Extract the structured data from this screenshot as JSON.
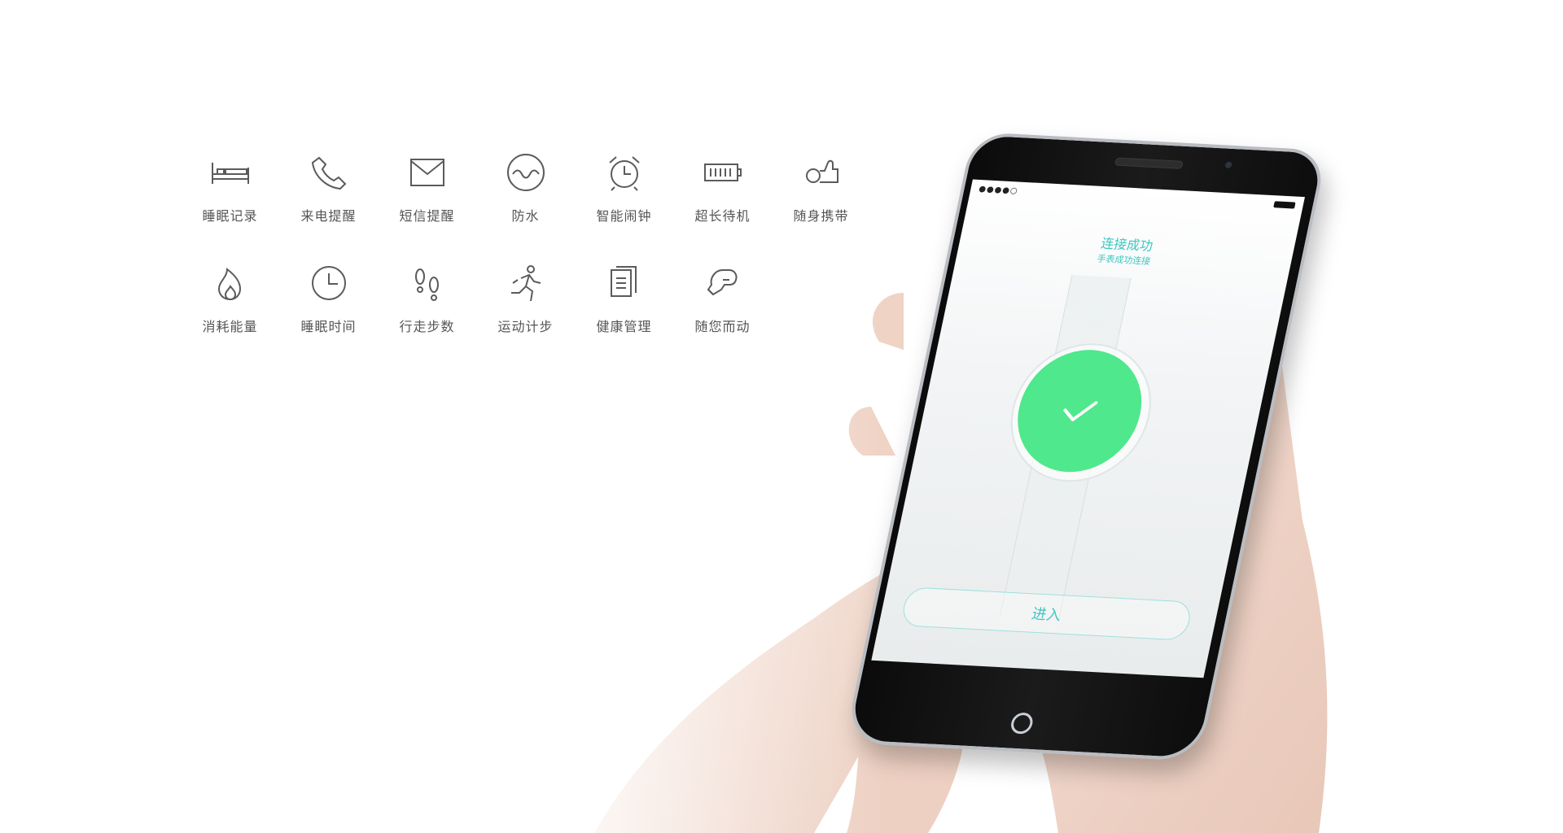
{
  "features": {
    "row1": [
      {
        "label": "睡眠记录",
        "icon": "bed-icon"
      },
      {
        "label": "来电提醒",
        "icon": "phone-icon"
      },
      {
        "label": "短信提醒",
        "icon": "envelope-icon"
      },
      {
        "label": "防水",
        "icon": "water-wave-icon"
      },
      {
        "label": "智能闹钟",
        "icon": "alarm-clock-icon"
      },
      {
        "label": "超长待机",
        "icon": "battery-icon"
      },
      {
        "label": "随身携带",
        "icon": "watch-hand-icon"
      }
    ],
    "row2": [
      {
        "label": "消耗能量",
        "icon": "flame-icon"
      },
      {
        "label": "睡眠时间",
        "icon": "clock-icon"
      },
      {
        "label": "行走步数",
        "icon": "footprints-icon"
      },
      {
        "label": "运动计步",
        "icon": "runner-icon"
      },
      {
        "label": "健康管理",
        "icon": "document-icon"
      },
      {
        "label": "随您而动",
        "icon": "boxing-glove-icon"
      }
    ]
  },
  "phone": {
    "status_signal": "●●●●○ ",
    "status_time": "",
    "status_battery": "",
    "title": "连接成功",
    "subtitle": "手表成功连接",
    "enter_label": "进入"
  },
  "colors": {
    "accent": "#3ec7c0",
    "success": "#4fe88c",
    "icon_gray": "#5b5b5b"
  }
}
